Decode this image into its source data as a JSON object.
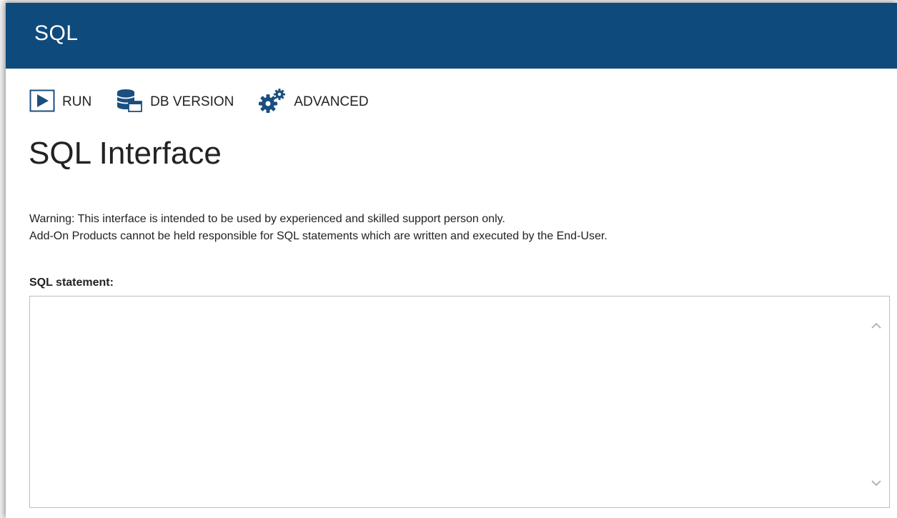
{
  "window": {
    "title": "SQL"
  },
  "toolbar": {
    "run_label": "RUN",
    "run_icon": "play-icon",
    "db_version_label": "DB VERSION",
    "db_version_icon": "database-icon",
    "advanced_label": "ADVANCED",
    "advanced_icon": "gears-icon"
  },
  "main": {
    "heading": "SQL Interface",
    "warning_line1": "Warning: This interface is intended to be used by experienced and skilled support person only.",
    "warning_line2": "Add-On Products cannot be held responsible for SQL statements which are written and executed by the End-User.",
    "statement_label": "SQL statement:",
    "statement_value": ""
  },
  "colors": {
    "titlebar": "#0f4a7c",
    "icon_blue": "#1a4f80"
  }
}
